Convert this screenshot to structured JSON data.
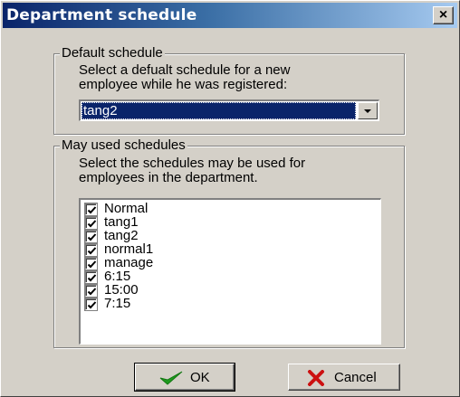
{
  "window": {
    "title": "Department schedule",
    "close_glyph": "×"
  },
  "default_group": {
    "legend": "Default schedule",
    "description_line1": "Select a defualt schedule for a new",
    "description_line2": "employee while he was registered:",
    "selected_value": "tang2"
  },
  "used_group": {
    "legend": "May used schedules",
    "description_line1": "Select the schedules may be used for",
    "description_line2": "employees in the department.",
    "items": [
      {
        "label": "Normal",
        "checked": true
      },
      {
        "label": "tang1",
        "checked": true
      },
      {
        "label": "tang2",
        "checked": true
      },
      {
        "label": "normal1",
        "checked": true
      },
      {
        "label": "manage",
        "checked": true
      },
      {
        "label": "6:15",
        "checked": true
      },
      {
        "label": "15:00",
        "checked": true
      },
      {
        "label": "7:15",
        "checked": true
      }
    ]
  },
  "buttons": {
    "ok_label": "OK",
    "ok_icon": "green-checkmark-icon",
    "cancel_label": "Cancel",
    "cancel_icon": "red-x-icon"
  },
  "colors": {
    "title_bar": "#0a246a",
    "selection": "#0a246a",
    "ok_check": "#1f9a1f",
    "cancel_x": "#cc1111"
  }
}
